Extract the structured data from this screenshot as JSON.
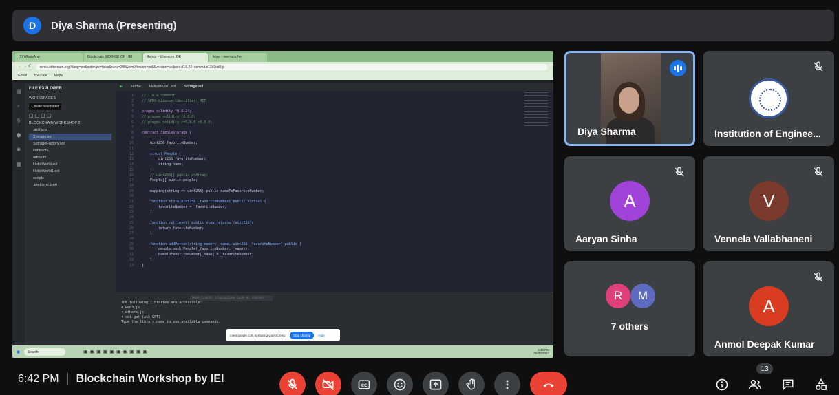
{
  "presenter": {
    "initial": "D",
    "label": "Diya Sharma (Presenting)"
  },
  "shared_screen": {
    "browser_tabs": [
      "(1) WhatsApp",
      "Blockchain WORKSHOP | IEI",
      "Remix - Ethereum IDE",
      "Meet - ixw-raou-her"
    ],
    "url": "remix.ethereum.org/#lang=en&optimize=false&runs=200&evmVersion=null&version=soljson-v0.8.24+commit.e11b9ed9.js",
    "bookmarks": [
      "Gmail",
      "YouTube",
      "Maps"
    ],
    "explorer_title": "FILE EXPLORER",
    "workspaces": "WORKSPACES",
    "tooltip": "Create new folder",
    "files": [
      "BLOCKCHAIN WORKSHOP 2",
      ".artifacts",
      "Storage.sol",
      "StorageFactory.sol",
      "contracts",
      "artifacts",
      "HelloWorld.sol",
      "HelloWorld1.sol",
      "scripts",
      ".prettierrc.json"
    ],
    "editor_tabs": [
      "Home",
      "HelloWorld1.sol",
      "Storage.sol"
    ],
    "code_lines": [
      {
        "n": "1",
        "t": "// I'm a comment!",
        "c": "c"
      },
      {
        "n": "2",
        "t": "// SPDX-License-Identifier: MIT",
        "c": "c"
      },
      {
        "n": "3",
        "t": "",
        "c": ""
      },
      {
        "n": "4",
        "t": "pragma solidity ^0.8.24;",
        "c": "k"
      },
      {
        "n": "5",
        "t": "// pragma solidity ^0.8.0;",
        "c": "c"
      },
      {
        "n": "6",
        "t": "// pragma solidity >=0.8.0 <0.9.0;",
        "c": "c"
      },
      {
        "n": "7",
        "t": "",
        "c": ""
      },
      {
        "n": "8",
        "t": "contract SimpleStorage {",
        "c": "k"
      },
      {
        "n": "9",
        "t": "",
        "c": ""
      },
      {
        "n": "10",
        "t": "    uint256 favoriteNumber;",
        "c": ""
      },
      {
        "n": "11",
        "t": "",
        "c": ""
      },
      {
        "n": "12",
        "t": "    struct People {",
        "c": "t"
      },
      {
        "n": "13",
        "t": "        uint256 favoriteNumber;",
        "c": ""
      },
      {
        "n": "14",
        "t": "        string name;",
        "c": ""
      },
      {
        "n": "15",
        "t": "    }",
        "c": ""
      },
      {
        "n": "16",
        "t": "    // uint256[] public anArray;",
        "c": "c"
      },
      {
        "n": "17",
        "t": "    People[] public people;",
        "c": ""
      },
      {
        "n": "18",
        "t": "",
        "c": ""
      },
      {
        "n": "19",
        "t": "    mapping(string => uint256) public nameToFavoriteNumber;",
        "c": ""
      },
      {
        "n": "20",
        "t": "",
        "c": ""
      },
      {
        "n": "21",
        "t": "    function store(uint256 _favoriteNumber) public virtual {",
        "c": "t"
      },
      {
        "n": "22",
        "t": "        favoriteNumber = _favoriteNumber;",
        "c": ""
      },
      {
        "n": "23",
        "t": "    }",
        "c": ""
      },
      {
        "n": "24",
        "t": "",
        "c": ""
      },
      {
        "n": "25",
        "t": "    function retrieve() public view returns (uint256){",
        "c": "t"
      },
      {
        "n": "26",
        "t": "        return favoriteNumber;",
        "c": ""
      },
      {
        "n": "27",
        "t": "    }",
        "c": ""
      },
      {
        "n": "28",
        "t": "",
        "c": ""
      },
      {
        "n": "29",
        "t": "    function addPerson(string memory _name, uint256 _favoriteNumber) public {",
        "c": "t"
      },
      {
        "n": "30",
        "t": "        people.push(People(_favoriteNumber, _name));",
        "c": ""
      },
      {
        "n": "31",
        "t": "        nameToFavoriteNumber[_name] = _favoriteNumber;",
        "c": ""
      },
      {
        "n": "32",
        "t": "    }",
        "c": ""
      },
      {
        "n": "33",
        "t": "}",
        "c": ""
      }
    ],
    "terminal_search": "Search with transaction hash or address",
    "terminal_lines": [
      "The following libraries are accessible:",
      "• web3.js",
      "• ethers.js",
      "• sol-gpt (Ask GPT)",
      "",
      "Type the library name to see available commands."
    ],
    "share_notice": "meet.google.com is sharing your screen.",
    "stop_sharing": "Stop sharing",
    "hide": "Hide",
    "taskbar_search": "Search",
    "taskbar_time": "6:42 PM",
    "taskbar_date": "06/03/2024"
  },
  "participants": [
    {
      "name": "Diya Sharma"
    },
    {
      "name": "Institution of Enginee..."
    },
    {
      "name": "Aaryan Sinha",
      "initial": "A",
      "color": "#a142d9"
    },
    {
      "name": "Vennela Vallabhaneni",
      "initial": "V",
      "color": "#7a3a2c"
    },
    {
      "name": "7 others",
      "initials": [
        "R",
        "M"
      ],
      "colors": [
        "#e0407a",
        "#5c6bc0"
      ]
    },
    {
      "name": "Anmol Deepak Kumar",
      "initial": "A",
      "color": "#d93c21"
    }
  ],
  "footer": {
    "time": "6:42 PM",
    "meeting_title": "Blockchain Workshop by IEI",
    "participant_count": "13"
  }
}
